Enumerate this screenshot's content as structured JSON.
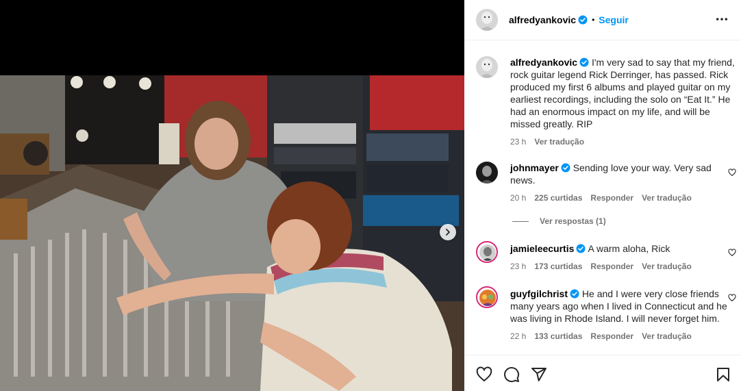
{
  "post": {
    "author": "alfredyankovic",
    "follow_label": "Seguir",
    "separator": "•",
    "caption": "I'm very sad to say that my friend, rock guitar legend Rick Derringer, has passed. Rick produced my first 6 albums and played guitar on my earliest recordings, including the solo on “Eat It.” He had an enormous impact on my life, and will be missed greatly. RIP",
    "time": "23 h",
    "translate_label": "Ver tradução"
  },
  "comments": [
    {
      "user": "johnmayer",
      "text": "Sending love your way. Very sad news.",
      "time": "20 h",
      "likes": "225 curtidas",
      "reply_label": "Responder",
      "translate_label": "Ver tradução",
      "replies_label": "Ver respostas (1)"
    },
    {
      "user": "jamieleecurtis",
      "text": "A warm aloha, Rick",
      "time": "23 h",
      "likes": "173 curtidas",
      "reply_label": "Responder",
      "translate_label": "Ver tradução"
    },
    {
      "user": "guyfgilchrist",
      "text": "He and I were very close friends many years ago when I lived in Connecticut and he was living in Rhode Island. I will never forget him.",
      "time": "22 h",
      "likes": "133 curtidas",
      "reply_label": "Responder",
      "translate_label": "Ver tradução"
    }
  ],
  "icons": {
    "more": "more-options-icon",
    "verified": "verified-badge-icon",
    "like": "heart-icon",
    "comment": "comment-icon",
    "share": "share-icon",
    "save": "bookmark-icon",
    "next": "chevron-right-icon"
  },
  "colors": {
    "accent": "#0095f6",
    "verified": "#0095f6",
    "muted_text": "#737373",
    "text": "#262626"
  }
}
